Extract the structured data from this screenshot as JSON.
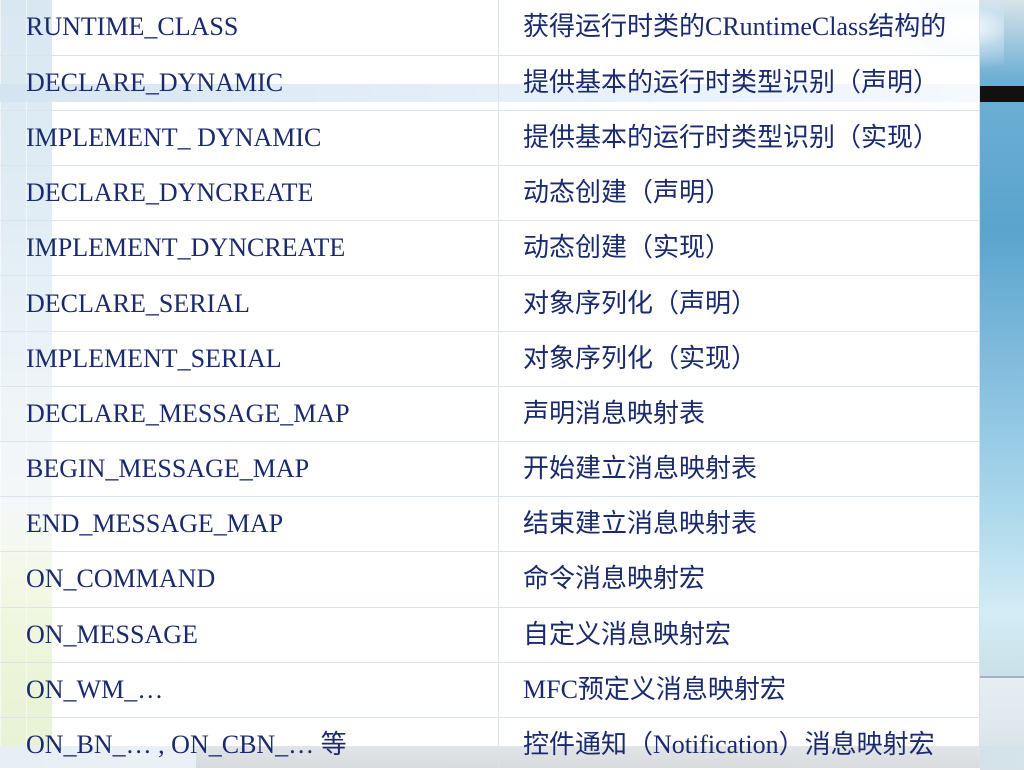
{
  "table": {
    "rows": [
      {
        "macro": "RUNTIME_CLASS",
        "description": "获得运行时类的CRuntimeClass结构的"
      },
      {
        "macro": "DECLARE_DYNAMIC",
        "description": "提供基本的运行时类型识别（声明）"
      },
      {
        "macro": "IMPLEMENT_ DYNAMIC",
        "description": "提供基本的运行时类型识别（实现）"
      },
      {
        "macro": "DECLARE_DYNCREATE",
        "description": "动态创建（声明）"
      },
      {
        "macro": "IMPLEMENT_DYNCREATE",
        "description": "动态创建（实现）"
      },
      {
        "macro": "DECLARE_SERIAL",
        "description": "对象序列化（声明）"
      },
      {
        "macro": "IMPLEMENT_SERIAL",
        "description": "对象序列化（实现）"
      },
      {
        "macro": "DECLARE_MESSAGE_MAP",
        "description": "声明消息映射表"
      },
      {
        "macro": "BEGIN_MESSAGE_MAP",
        "description": "开始建立消息映射表"
      },
      {
        "macro": "END_MESSAGE_MAP",
        "description": "结束建立消息映射表"
      },
      {
        "macro": "ON_COMMAND",
        "description": "命令消息映射宏"
      },
      {
        "macro": "ON_MESSAGE",
        "description": "自定义消息映射宏"
      },
      {
        "macro": "ON_WM_…",
        "description": "MFC预定义消息映射宏"
      },
      {
        "macro": "ON_BN_… , ON_CBN_… 等",
        "description": "控件通知（Notification）消息映射宏"
      }
    ]
  },
  "colors": {
    "text": "#1a2a6c",
    "grid": "#dde3ea",
    "accent_blue": "#4e93bf",
    "accent_green": "#93c23d"
  }
}
